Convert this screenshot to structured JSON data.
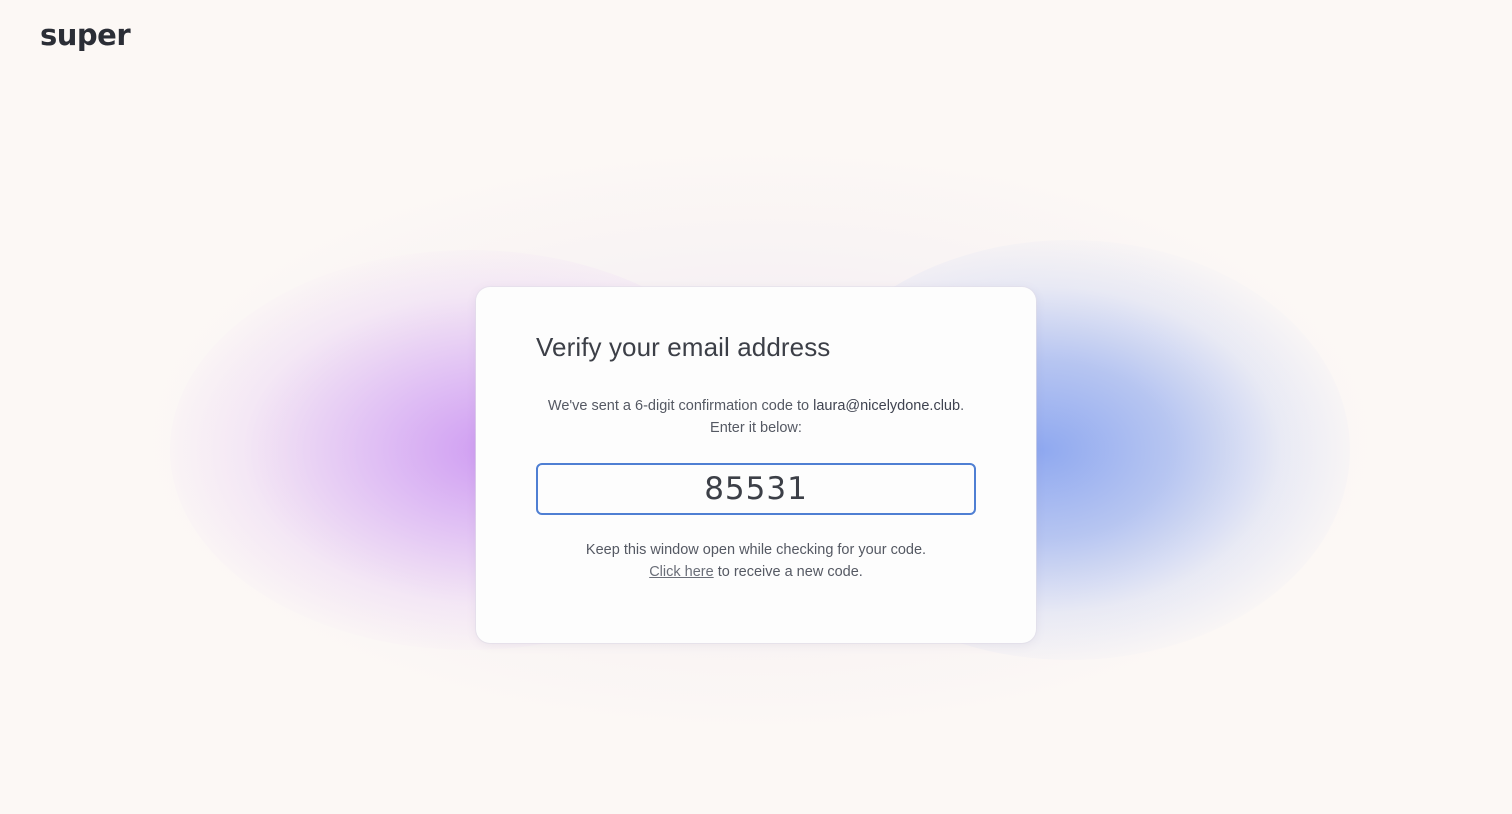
{
  "brand": {
    "logo_text": "super"
  },
  "colors": {
    "background": "#fcf8f5",
    "card": "#fdfdfd",
    "input_border": "#4f7fd3",
    "glow_left": "#cc96f2",
    "glow_right": "#8aa5f0"
  },
  "verify": {
    "title": "Verify your email address",
    "message_prefix": "We've sent a 6-digit confirmation code to ",
    "email": "laura@nicelydone.club",
    "message_suffix": ".",
    "message_line2": "Enter it below:",
    "code_value": "85531",
    "keep_open_text": "Keep this window open while checking for your code.",
    "resend_link": "Click here",
    "resend_suffix": " to receive a new code."
  }
}
